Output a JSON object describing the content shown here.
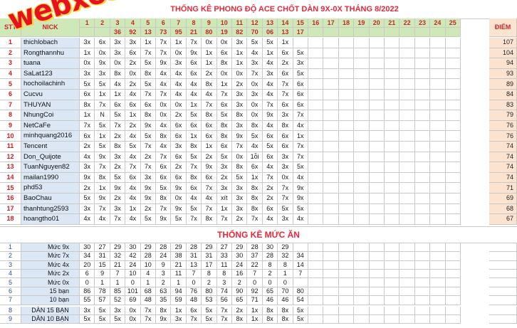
{
  "title": "THỐNG KÊ PHONG ĐỘ ACE CHỐT DÀN 9X-0X THÁNG 8/2022",
  "header": {
    "stt": "STT",
    "nick": "NICK",
    "score": "ĐIỂM"
  },
  "days": [
    "1",
    "2",
    "3",
    "4",
    "5",
    "6",
    "7",
    "8",
    "9",
    "10",
    "11",
    "12",
    "13",
    "14",
    "15",
    "16",
    "17",
    "18",
    "19",
    "20",
    "21",
    "22",
    "23",
    "24",
    "25"
  ],
  "results": [
    "",
    "",
    "36",
    "92",
    "13",
    "73",
    "95",
    "21",
    "80",
    "19",
    "82",
    "70",
    "06",
    "13",
    "17"
  ],
  "players": [
    {
      "nick": "thichlobach",
      "marks": [
        "3x",
        "6x",
        "3x",
        "3x",
        "1x",
        "7x",
        "1x",
        "7x",
        "0x",
        "0x",
        "3x",
        "5x",
        "5x",
        "1x"
      ],
      "score": "107"
    },
    {
      "nick": "Rongthannhu",
      "marks": [
        "1x",
        "0x",
        "3x",
        "6x",
        "7x",
        "7x",
        "0x",
        "9x",
        "1x",
        "6x",
        "1x",
        "4x",
        "1x",
        "6x",
        "5x"
      ],
      "score": "104"
    },
    {
      "nick": "tuana",
      "marks": [
        "0x",
        "9x",
        "0x",
        "2x",
        "5x",
        "9x",
        "3x",
        "6x",
        "1x",
        "8x",
        "1x",
        "3x",
        "4x",
        "2x",
        "3x"
      ],
      "score": "94"
    },
    {
      "nick": "SaLat123",
      "marks": [
        "3x",
        "3x",
        "8x",
        "0x",
        "8x",
        "4x",
        "4x",
        "6x",
        "2x",
        "0x",
        "0x",
        "7x",
        "3x",
        "6x",
        "5x"
      ],
      "score": "93"
    },
    {
      "nick": "hochoilachinh",
      "marks": [
        "5x",
        "5x",
        "4x",
        "2x",
        "5x",
        "4x",
        "4x",
        "4x",
        "8x",
        "1x",
        "2x",
        "0x",
        "4x",
        "7x",
        "6x"
      ],
      "score": "89"
    },
    {
      "nick": "Cucvu",
      "marks": [
        "6x",
        "1x",
        "1x",
        "4x",
        "7x",
        "7x",
        "4x",
        "4x",
        "4x",
        "7x",
        "3x",
        "3x",
        "4x",
        "7x",
        "6x"
      ],
      "score": "84"
    },
    {
      "nick": "THUYAN",
      "marks": [
        "8x",
        "7x",
        "6x",
        "6x",
        "6x",
        "0x",
        "0x",
        "1x",
        "7x",
        "6x",
        "3x",
        "0x",
        "7x",
        "6x",
        "6x"
      ],
      "score": "83"
    },
    {
      "nick": "NhungCoi",
      "marks": [
        "1x",
        "N",
        "5x",
        "1x",
        "8x",
        "0x",
        "2x",
        "5x",
        "8x",
        "5x",
        "8x",
        "0x",
        "9x",
        "3x",
        "7x"
      ],
      "score": "79"
    },
    {
      "nick": "NetCaFe",
      "marks": [
        "7x",
        "5x",
        "7x",
        "2x",
        "9x",
        "4x",
        "6x",
        "6x",
        "6x",
        "8x",
        "3x",
        "8x",
        "4x",
        "8x",
        "4x"
      ],
      "score": "76"
    },
    {
      "nick": "minhquang2016",
      "marks": [
        "6x",
        "1x",
        "2x",
        "4x",
        "5x",
        "8x",
        "6x",
        "1x",
        "6x",
        "8x",
        "9x",
        "5x",
        "6x",
        "6x",
        "1x"
      ],
      "score": "76"
    },
    {
      "nick": "Tencent",
      "marks": [
        "2x",
        "5x",
        "8x",
        "5x",
        "7x",
        "4x",
        "3x",
        "8x",
        "1x",
        "6x",
        "7x",
        "4x",
        "5x",
        "6x",
        "7x"
      ],
      "score": "74"
    },
    {
      "nick": "Don_Quijote",
      "marks": [
        "4x",
        "9x",
        "3x",
        "4x",
        "2x",
        "7x",
        "6x",
        "5x",
        "2x",
        "5x",
        "0x",
        "1ỗi",
        "6x",
        "3x",
        "7x"
      ],
      "score": "74"
    },
    {
      "nick": "TuanNguyen82",
      "marks": [
        "3x",
        "7x",
        "2x",
        "7x",
        "7x",
        "6x",
        "2x",
        "7x",
        "9x",
        "3x",
        "8x",
        "6x",
        "4x",
        "3x",
        "5x"
      ],
      "score": "74"
    },
    {
      "nick": "mailan1990",
      "marks": [
        "9x",
        "8x",
        "5x",
        "6x",
        "3x",
        "6x",
        "6x",
        "8x",
        "6x",
        "2x",
        "5x",
        "1x",
        "7x",
        "0x",
        "4x"
      ],
      "score": "74"
    },
    {
      "nick": "phd53",
      "marks": [
        "2x",
        "1x",
        "9x",
        "4x",
        "9x",
        "5x",
        "9x",
        "6x",
        "7x",
        "3x",
        "3x",
        "8x",
        "2x",
        "7x",
        "9x"
      ],
      "score": "71"
    },
    {
      "nick": "BaoChau",
      "marks": [
        "5x",
        "9x",
        "2x",
        "4x",
        "9x",
        "8x",
        "0x",
        "4x",
        "4x",
        "xít",
        "3x",
        "8x",
        "2x",
        "7x",
        "9x"
      ],
      "score": "69"
    },
    {
      "nick": "thanhtung2593",
      "marks": [
        "3x",
        "7x",
        "3x",
        "1x",
        "2x",
        "7x",
        "9x",
        "5x",
        "7x",
        "1x",
        "3x",
        "8x",
        "6x",
        "5x",
        "5x"
      ],
      "score": "68"
    },
    {
      "nick": "hoangtho01",
      "marks": [
        "4x",
        "4x",
        "7x",
        "4x",
        "5x",
        "9x",
        "5x",
        "7x",
        "8x",
        "7x",
        "2x",
        "7x",
        "4x",
        "3x",
        "4x"
      ],
      "score": "67"
    }
  ],
  "summary": {
    "title": "THỐNG KÊ MỨC ĂN",
    "rows": [
      {
        "stt": "1",
        "label": "Mức 9x",
        "values": [
          "30",
          "27",
          "29",
          "30",
          "29",
          "28",
          "29",
          "28",
          "29",
          "27",
          "29",
          "28",
          "30",
          "29"
        ]
      },
      {
        "stt": "2",
        "label": "Mức 7x",
        "values": [
          "34",
          "31",
          "32",
          "42",
          "28",
          "24",
          "38",
          "31",
          "31",
          "33",
          "30",
          "37",
          "28",
          "32",
          "34"
        ]
      },
      {
        "stt": "3",
        "label": "Mức 4x",
        "values": [
          "20",
          "15",
          "21",
          "24",
          "10",
          "9",
          "21",
          "13",
          "17",
          "11",
          "24",
          "22",
          "8",
          "8",
          "14"
        ]
      },
      {
        "stt": "4",
        "label": "Mức 2x",
        "values": [
          "6",
          "9",
          "7",
          "10",
          "4",
          "3",
          "11",
          "7",
          "8",
          "8",
          "16",
          "7",
          "2",
          "1",
          "7"
        ]
      },
      {
        "stt": "5",
        "label": "Mức 0x",
        "values": [
          "0",
          "1",
          "1",
          "0",
          "1",
          "2",
          "1",
          "0",
          "2",
          "3",
          "2",
          "0",
          "0",
          "0"
        ]
      },
      {
        "stt": "6",
        "label": "15 bạn",
        "values": [
          "86",
          "78",
          "85",
          "101",
          "68",
          "63",
          "94",
          "76",
          "80",
          "74",
          "90",
          "92",
          "65",
          "70",
          "80"
        ]
      },
      {
        "stt": "7",
        "label": "10 bạn",
        "values": [
          "55",
          "57",
          "52",
          "69",
          "48",
          "35",
          "59",
          "48",
          "53",
          "56",
          "65",
          "71",
          "46",
          "46",
          "54"
        ]
      }
    ],
    "dan_rows": [
      {
        "stt": "8",
        "label": "DÀN 15 BẠN",
        "values": [
          "3x",
          "5x",
          "3x",
          "0x",
          "7x",
          "8x",
          "1x",
          "6x",
          "5x",
          "7x",
          "2x",
          "1x",
          "8x",
          "8x",
          "5x"
        ]
      },
      {
        "stt": "9",
        "label": "DÀN 10 BẠN",
        "values": [
          "5x",
          "5x",
          "5x",
          "0x",
          "7x",
          "9x",
          "3x",
          "7x",
          "5x",
          "7x",
          "8x",
          "1x",
          "8x",
          "8x",
          "5x"
        ]
      }
    ]
  },
  "watermark": "webxoso.net",
  "colors": {
    "header_bg": "#cfe8b8",
    "nick_bg": "#dbe7f5",
    "score_bg": "#fbe3cf",
    "accent_red": "#c62828"
  }
}
